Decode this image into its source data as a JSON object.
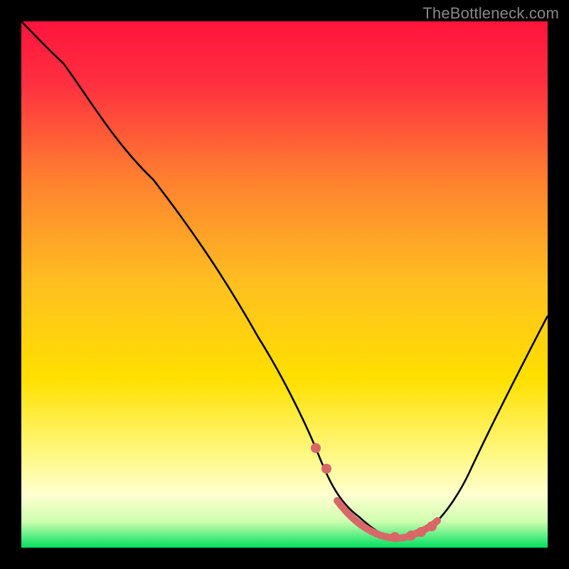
{
  "watermark": "TheBottleneck.com",
  "colors": {
    "background": "#000000",
    "gradient_top": "#ff143c",
    "gradient_mid": "#ffe000",
    "gradient_low": "#ffffc0",
    "gradient_bottom": "#00e060",
    "curve": "#000000",
    "accent": "#e07070",
    "accent_fill": "#d86868"
  },
  "chart_data": {
    "type": "line",
    "title": "",
    "xlabel": "",
    "ylabel": "",
    "xlim": [
      0,
      100
    ],
    "ylim": [
      0,
      100
    ],
    "series": [
      {
        "name": "bottleneck-curve",
        "x": [
          0,
          3,
          8,
          15,
          25,
          35,
          45,
          52,
          56,
          60,
          64,
          68,
          71,
          74,
          78,
          85,
          92,
          100
        ],
        "values": [
          100,
          97,
          92,
          84,
          70,
          55,
          40,
          27,
          19,
          12,
          6,
          3,
          2,
          2,
          4,
          14,
          27,
          44
        ]
      }
    ],
    "flat_region": {
      "x_start": 56,
      "x_end": 78
    },
    "accent_dots": [
      {
        "x": 56,
        "y": 19
      },
      {
        "x": 58,
        "y": 15
      },
      {
        "x": 71,
        "y": 2
      },
      {
        "x": 74,
        "y": 2
      },
      {
        "x": 76,
        "y": 3
      },
      {
        "x": 78,
        "y": 4
      }
    ]
  }
}
